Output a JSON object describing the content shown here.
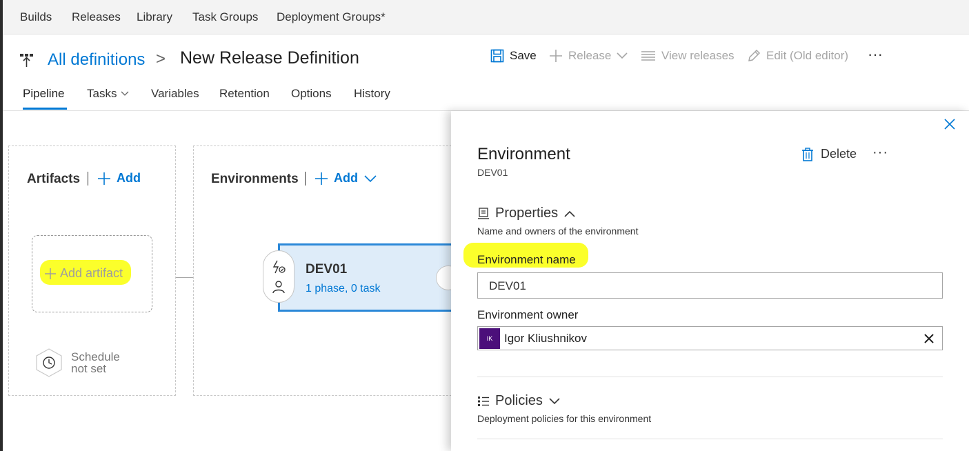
{
  "topnav": {
    "items": [
      "Builds",
      "Releases",
      "Library",
      "Task Groups",
      "Deployment Groups*"
    ]
  },
  "header": {
    "breadcrumb_link": "All definitions",
    "breadcrumb_separator": ">",
    "title": "New Release Definition",
    "toolbar": {
      "save": "Save",
      "release": "Release",
      "view_releases": "View releases",
      "edit_old": "Edit (Old editor)",
      "more": "···"
    },
    "tabs": [
      "Pipeline",
      "Tasks",
      "Variables",
      "Retention",
      "Options",
      "History"
    ],
    "active_tab": "Pipeline"
  },
  "canvas": {
    "artifacts": {
      "title": "Artifacts",
      "add_label": "Add",
      "add_artifact": "Add artifact",
      "schedule_line1": "Schedule",
      "schedule_line2": "not set"
    },
    "environments": {
      "title": "Environments",
      "add_label": "Add",
      "card": {
        "name": "DEV01",
        "summary": "1 phase, 0 task"
      }
    }
  },
  "panel": {
    "title": "Environment",
    "subtitle": "DEV01",
    "delete_label": "Delete",
    "more": "···",
    "properties": {
      "heading": "Properties",
      "description": "Name and owners of the environment",
      "env_name_label": "Environment name",
      "env_name_value": "DEV01",
      "env_owner_label": "Environment owner",
      "owner_initials": "IK",
      "owner_name": "Igor Kliushnikov"
    },
    "policies": {
      "heading": "Policies",
      "description": "Deployment policies for this environment"
    }
  },
  "colors": {
    "accent": "#0078d4",
    "highlight": "#fbff2b",
    "card_bg": "#deecf9",
    "avatar_bg": "#4b0f7a"
  }
}
